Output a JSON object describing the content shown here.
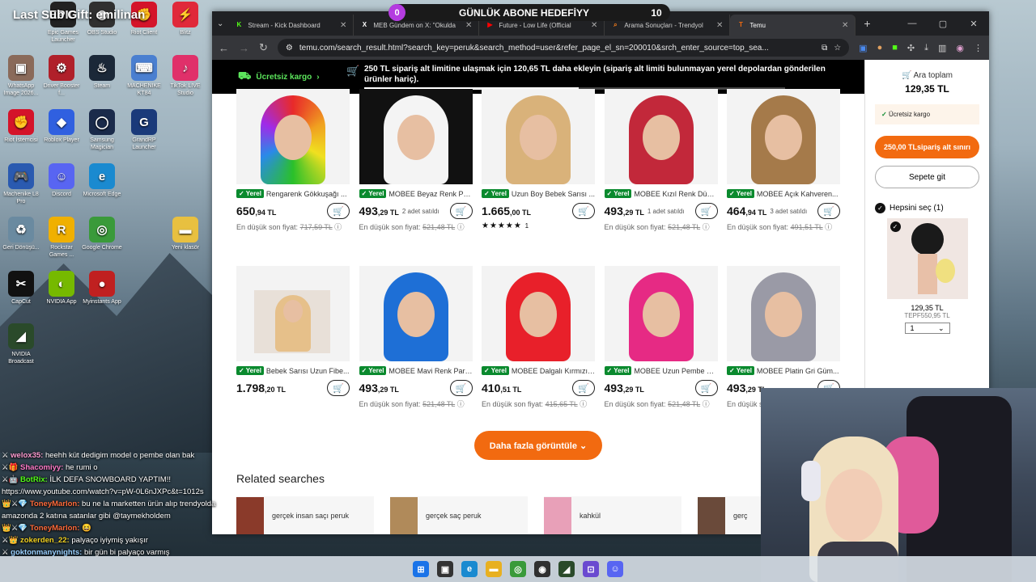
{
  "desktop": {
    "stream_title": "Last Sub Gift: emilinan",
    "icons": [
      {
        "label": "Epic Games Launcher",
        "color": "#222",
        "glyph": "EPIC"
      },
      {
        "label": "OBS Studio",
        "color": "#303030",
        "glyph": "◉"
      },
      {
        "label": "Riot Client",
        "color": "#d4142a",
        "glyph": "✊"
      },
      {
        "label": "Blitz",
        "color": "#e0283a",
        "glyph": "⚡"
      },
      {
        "label": "WhatsApp Image 2026...",
        "color": "#8a6a5a",
        "glyph": "▣"
      },
      {
        "label": "Driver Booster f...",
        "color": "#b0202a",
        "glyph": "⚙"
      },
      {
        "label": "Steam",
        "color": "#1b2838",
        "glyph": "♨"
      },
      {
        "label": "MACHENIKE KT84",
        "color": "#4a7fd0",
        "glyph": "⌨"
      },
      {
        "label": "TikTok LIVE Studio",
        "color": "#e0306a",
        "glyph": "♪"
      },
      {
        "label": "Riot İstemcisi",
        "color": "#d4142a",
        "glyph": "✊"
      },
      {
        "label": "Roblox Player",
        "color": "#3060e0",
        "glyph": "◆"
      },
      {
        "label": "Samsung Magician",
        "color": "#1a2a4a",
        "glyph": "◯"
      },
      {
        "label": "GrandRP Launcher",
        "color": "#1a3a7a",
        "glyph": "G"
      },
      {
        "label": "Machenike L8 Pro",
        "color": "#2a5ab0",
        "glyph": "🎮"
      },
      {
        "label": "Discord",
        "color": "#5865f2",
        "glyph": "☺"
      },
      {
        "label": "Microsoft Edge",
        "color": "#1a8ad0",
        "glyph": "e"
      },
      {
        "label": "Geri Dönüşü...",
        "color": "#6a8aa0",
        "glyph": "♻"
      },
      {
        "label": "Rockstar Games ...",
        "color": "#f0b000",
        "glyph": "R"
      },
      {
        "label": "Google Chrome",
        "color": "#3a9a3a",
        "glyph": "◎"
      },
      {
        "label": "Yeni klasör",
        "color": "#e8c040",
        "glyph": "▬"
      },
      {
        "label": "CapCut",
        "color": "#111",
        "glyph": "✂"
      },
      {
        "label": "NVIDIA App",
        "color": "#76b900",
        "glyph": "◐"
      },
      {
        "label": "Myinstants App",
        "color": "#c02020",
        "glyph": "●"
      },
      {
        "label": "NVIDIA Broadcast",
        "color": "#2a4a2a",
        "glyph": "◢"
      }
    ]
  },
  "goal": {
    "left": "0",
    "title": "GÜNLÜK ABONE HEDEFİYY",
    "right": "10"
  },
  "browser": {
    "tabs": [
      {
        "title": "Stream - Kick Dashboard",
        "icon": "K",
        "color": "#53fc18"
      },
      {
        "title": "MEB Gündem on X: \"Okulda",
        "icon": "X",
        "color": "#fff"
      },
      {
        "title": "Future - Low Life (Official",
        "icon": "▶",
        "color": "#ff0000"
      },
      {
        "title": "Arama Sonuçları - Trendyol",
        "icon": "⌕",
        "color": "#f27a1a"
      },
      {
        "title": "Temu",
        "icon": "T",
        "color": "#f26a10"
      }
    ],
    "url": "temu.com/search_result.html?search_key=peruk&search_method=user&refer_page_el_sn=200010&srch_enter_source=top_sea..."
  },
  "banner": {
    "free_shipping": "Ücretsiz kargo",
    "message": "250 TL sipariş alt limitine ulaşmak için 120,65 TL daha ekleyin (sipariş alt limiti bulunmayan yerel depolardan gönderilen ürünler hariç).",
    "progress": 0.51
  },
  "products": [
    {
      "name": "Rengarenk Gökkuşağı ...",
      "price_main": "650",
      "price_dec": ",94 TL",
      "sold": "",
      "lowest_label": "En düşük son fiyat:",
      "lowest": "717,59 TL",
      "hair": "rainbow"
    },
    {
      "name": "MOBEE Beyaz Renk Pe...",
      "price_main": "493",
      "price_dec": ",29 TL",
      "sold": "2 adet satıldı",
      "lowest_label": "En düşük son fiyat:",
      "lowest": "521,48 TL",
      "hair": "#f4f4f4"
    },
    {
      "name": "Uzun Boy Bebek Sarısı ...",
      "price_main": "1.665",
      "price_dec": ",00 TL",
      "sold": "",
      "lowest_label": "",
      "lowest": "",
      "stars": "★★★★★",
      "rating_count": "1",
      "hair": "#d9b27a"
    },
    {
      "name": "MOBEE Kızıl Renk Düz ...",
      "price_main": "493",
      "price_dec": ",29 TL",
      "sold": "1 adet satıldı",
      "lowest_label": "En düşük son fiyat:",
      "lowest": "521,48 TL",
      "hair": "#c2283a"
    },
    {
      "name": "MOBEE Açık Kahveren...",
      "price_main": "464",
      "price_dec": ",94 TL",
      "sold": "3 adet satıldı",
      "lowest_label": "En düşük son fiyat:",
      "lowest": "491,51 TL",
      "hair": "#a57a4a"
    },
    {
      "name": "Bebek Sarısı Uzun Fibe...",
      "price_main": "1.798",
      "price_dec": ",20 TL",
      "sold": "",
      "lowest_label": "",
      "lowest": "",
      "hair": "#e6c08a"
    },
    {
      "name": "MOBEE Mavi Renk Part...",
      "price_main": "493",
      "price_dec": ",29 TL",
      "sold": "",
      "lowest_label": "En düşük son fiyat:",
      "lowest": "521,48 TL",
      "hair": "#1e6fd6"
    },
    {
      "name": "MOBEE Dalgalı Kırmızı ...",
      "price_main": "410",
      "price_dec": ",51 TL",
      "sold": "",
      "lowest_label": "En düşük son fiyat:",
      "lowest": "415,65 TL",
      "hair": "#e8202a"
    },
    {
      "name": "MOBEE Uzun Pembe R...",
      "price_main": "493",
      "price_dec": ",29 TL",
      "sold": "",
      "lowest_label": "En düşük son fiyat:",
      "lowest": "521,48 TL",
      "hair": "#e62a84"
    },
    {
      "name": "MOBEE Platin Gri Güm...",
      "price_main": "493",
      "price_dec": ",29 TL",
      "sold": "",
      "lowest_label": "En düşük son fiyat:",
      "lowest": "",
      "hair": "#9a9aa6"
    }
  ],
  "yerel_label": "Yerel",
  "more_button": "Daha fazla görüntüle ⌄",
  "related": {
    "title": "Related searches",
    "items": [
      {
        "label": "gerçek insan saçı peruk",
        "color": "#8a3a2a"
      },
      {
        "label": "gerçek saç peruk",
        "color": "#b08a5a"
      },
      {
        "label": "kahkül",
        "color": "#e8a0b8"
      },
      {
        "label": "gerç",
        "color": "#6a4a3a"
      }
    ]
  },
  "cart": {
    "subtotal_label": "Ara toplam",
    "subtotal": "129,35 TL",
    "free_shipping": "Ücretsiz kargo",
    "min_order": "250,00 TLsipariş alt sınırı",
    "go_cart": "Sepete git",
    "select_all": "Hepsini seç (1)",
    "item_price": "129,35 TL",
    "item_old": "TEPF550,95 TL",
    "qty": "1"
  },
  "chat": [
    {
      "badges": "⚔",
      "user": "welox35:",
      "color": "#ff9ad0",
      "msg": "heehh küt dedigim model o pembe olan bak"
    },
    {
      "badges": "⚔🎁",
      "user": "Shacomiyy:",
      "color": "#ff7ac8",
      "msg": "he rumi o"
    },
    {
      "badges": "⚔🤖",
      "user": "BotRix:",
      "color": "#53fc18",
      "msg": "İLK DEFA SNOWBOARD YAPTIM!! https://www.youtube.com/watch?v=pW-0L6nJXPc&t=1012s"
    },
    {
      "badges": "👑⚔💎",
      "user": "ToneyMarlon:",
      "color": "#ff6a3a",
      "msg": "bu ne la marketten ürün alıp trendyolda amazonda 2 katına satanlar gibi @taymekholdem"
    },
    {
      "badges": "👑⚔💎",
      "user": "ToneyMarlon:",
      "color": "#ff6a3a",
      "msg": "😆"
    },
    {
      "badges": "⚔👑",
      "user": "zokerden_22:",
      "color": "#f0d020",
      "msg": "palyaço iyiymiş yakışır"
    },
    {
      "badges": "⚔",
      "user": "goktonmanynights:",
      "color": "#9ad0ff",
      "msg": "bir gün bi palyaço varmış"
    }
  ],
  "taskbar": [
    {
      "name": "windows-start-icon",
      "glyph": "⊞",
      "color": "#1a73e8"
    },
    {
      "name": "task-view-icon",
      "glyph": "▣",
      "color": "#333"
    },
    {
      "name": "edge-icon",
      "glyph": "e",
      "color": "#1a8ad0"
    },
    {
      "name": "file-explorer-icon",
      "glyph": "▬",
      "color": "#e8b020"
    },
    {
      "name": "chrome-icon",
      "glyph": "◎",
      "color": "#3a9a3a"
    },
    {
      "name": "obs-icon",
      "glyph": "◉",
      "color": "#303030"
    },
    {
      "name": "nvidia-icon",
      "glyph": "◢",
      "color": "#2a4a2a"
    },
    {
      "name": "app-icon",
      "glyph": "⊡",
      "color": "#6a4ad0"
    },
    {
      "name": "discord-icon",
      "glyph": "☺",
      "color": "#5865f2"
    }
  ]
}
